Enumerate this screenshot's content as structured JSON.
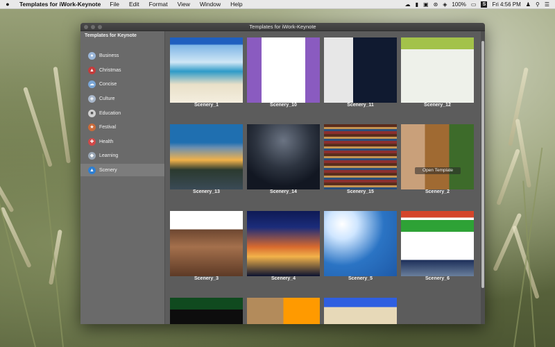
{
  "menubar": {
    "app_name": "Templates for iWork-Keynote",
    "menus": [
      "File",
      "Edit",
      "Format",
      "View",
      "Window",
      "Help"
    ],
    "battery": "100%",
    "clock": "Fri 4:56 PM"
  },
  "window": {
    "title": "Templates for iWork-Keynote"
  },
  "sidebar": {
    "header": "Templates for Keynote",
    "items": [
      {
        "label": "Business",
        "color": "#9bb7d9"
      },
      {
        "label": "Christmas",
        "color": "#c43c3c"
      },
      {
        "label": "Concise",
        "color": "#7aa6d6"
      },
      {
        "label": "Culture",
        "color": "#a8b6c9"
      },
      {
        "label": "Education",
        "color": "#d0d0d0"
      },
      {
        "label": "Festival",
        "color": "#c96a3a"
      },
      {
        "label": "Health",
        "color": "#d04848"
      },
      {
        "label": "Learning",
        "color": "#9aa7b5"
      },
      {
        "label": "Scenery",
        "color": "#2f7fd2",
        "selected": true
      }
    ]
  },
  "grid": {
    "open_label": "Open Template",
    "thumbs": [
      {
        "label": "Scenery_1",
        "bg": "linear-gradient(180deg,#1f5fbf 0%,#1f5fbf 10%,#7fb6e6 12%,#cfe6f5 38%,#2e9bc8 52%,#e9e0c8 72%,#f4eedf 100%)"
      },
      {
        "label": "Scenery_10",
        "bg": "linear-gradient(90deg,#8a5bc0 0 20%,#ffffff 20% 80%,#8a5bc0 80%)"
      },
      {
        "label": "Scenery_11",
        "bg": "linear-gradient(90deg,#e7e7e7 0 40%,#101a30 40%)"
      },
      {
        "label": "Scenery_12",
        "bg": "linear-gradient(180deg,#a3c24a 0 18%,#eef1ea 18%)"
      },
      {
        "label": "Scenery_13",
        "bg": "linear-gradient(180deg,#1f6fb0 0 28%,#6c8fb0 36%,#f0b14a 55%,#2b3a2f 70%,#3a4a56 100%)"
      },
      {
        "label": "Scenery_14",
        "bg": "radial-gradient(circle at 50% 25%,#6b7483 0%,#2d3440 45%,#121722 75%),linear-gradient(#000,#000)"
      },
      {
        "label": "Scenery_15",
        "bg": "repeating-linear-gradient(180deg,#5a2c1c 0 4px,#c49452 4px 7px,#2a4f7c 7px 10px,#8a2f2f 10px 14px)"
      },
      {
        "label": "Scenery_2",
        "bg": "linear-gradient(90deg,#c9a07a 0 33%,#a06a32 33% 66%,#3d6b2a 66%)"
      },
      {
        "label": "Scenery_3",
        "bg": "linear-gradient(180deg,#ffffff 0 28%,#6c4630 28%,#a4704c 55%,#5d3a26 100%)"
      },
      {
        "label": "Scenery_4",
        "bg": "linear-gradient(180deg,#0e1a55 0%,#1b2c7a 25%,#d86a2e 55%,#f2b24a 70%,#0b1230 100%)"
      },
      {
        "label": "Scenery_5",
        "bg": "radial-gradient(circle at 25% 20%,#ffffff 0%,#cfe6ff 20%,#2b74c4 55%,#1e5aa8 100%)"
      },
      {
        "label": "Scenery_6",
        "bg": "linear-gradient(180deg,#d4442a 0 10%,#ffffff 10% 14%,#2ea236 14% 32%,#ffffff 32% 75%,#1c2e59 75%,#6a7f9c 100%)"
      },
      {
        "label": "",
        "bg": "linear-gradient(180deg,#104a1f 0 45%,#0d0d0d 45%)"
      },
      {
        "label": "",
        "bg": "linear-gradient(90deg,#b38b5b 0 50%,#ff9a00 50%)"
      },
      {
        "label": "",
        "bg": "linear-gradient(180deg,#2f5fe0 0 35%,#e7d9b8 35%)"
      }
    ]
  }
}
